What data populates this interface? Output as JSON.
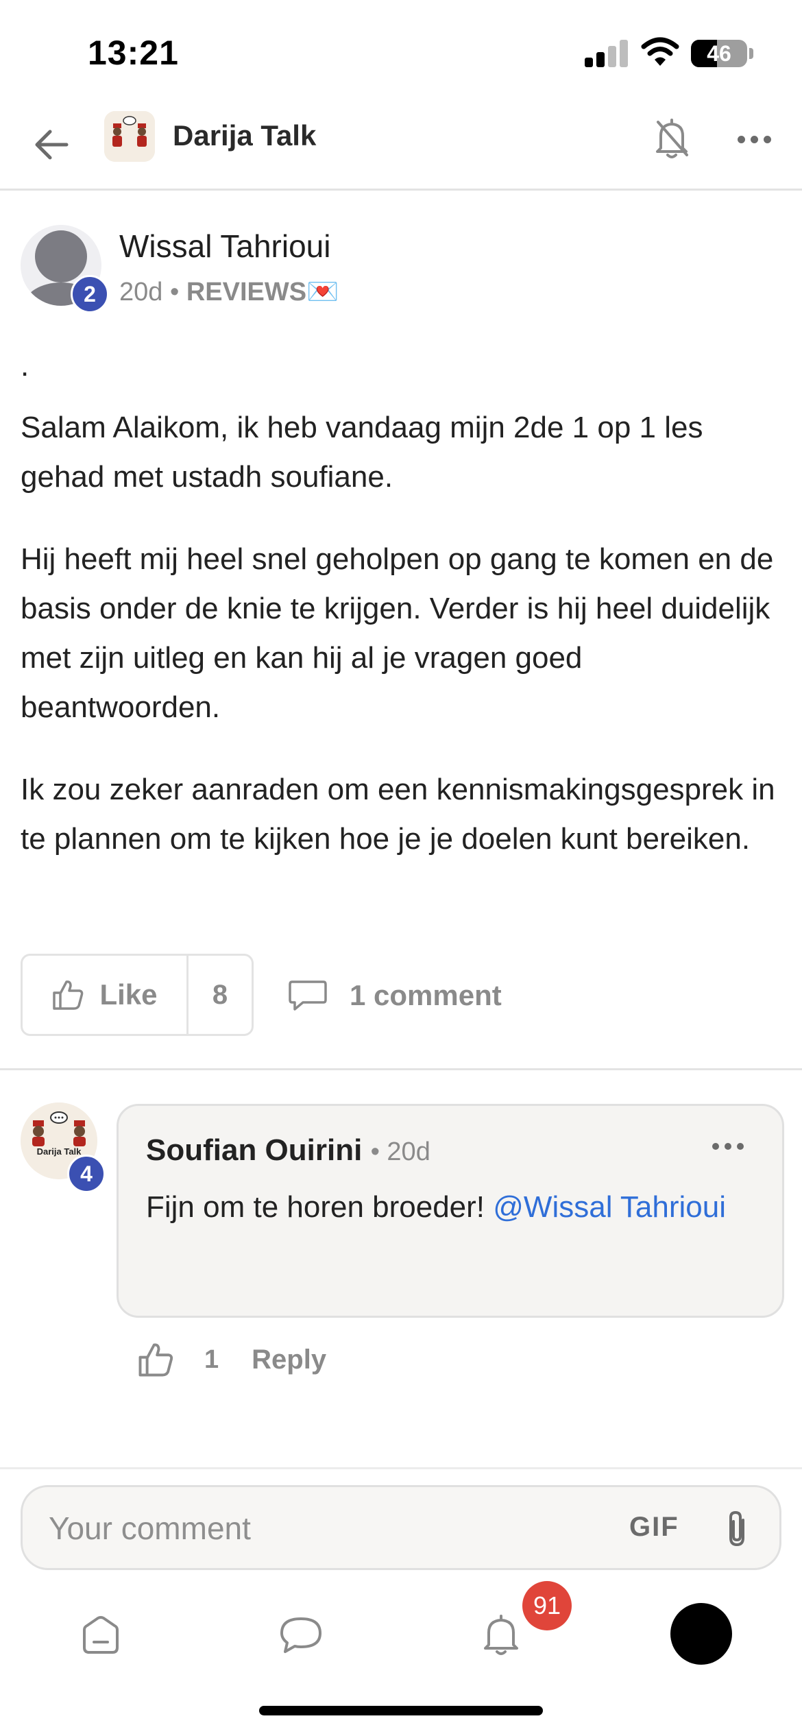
{
  "status_bar": {
    "time": "13:21",
    "battery_level": "46"
  },
  "header": {
    "group_title": "Darija Talk",
    "logo_text": "Darija Talk"
  },
  "post": {
    "author_name": "Wissal Tahrioui",
    "author_level": "2",
    "time_ago": "20d",
    "separator": "•",
    "category": "REVIEWS💌",
    "paragraphs": [
      ".",
      "Salam Alaikom, ik heb vandaag mijn 2de 1 op 1 les gehad met ustadh soufiane.",
      "Hij heeft mij heel snel geholpen op gang te komen en de basis onder de knie te krijgen. Verder is hij heel duidelijk met zijn uitleg en kan hij al je vragen goed beantwoorden.",
      "Ik zou zeker aanraden om een kennismakingsgesprek in te plannen om te kijken hoe je je doelen kunt bereiken."
    ],
    "like_label": "Like",
    "like_count": "8",
    "comment_count_label": "1 comment"
  },
  "comment": {
    "author_name": "Soufian Ouirini",
    "author_level": "4",
    "time_ago": "• 20d",
    "text": "Fijn om te horen broeder! ",
    "mention": "@Wissal Tahrioui",
    "like_count": "1",
    "reply_label": "Reply"
  },
  "composer": {
    "placeholder": "Your comment",
    "gif_label": "GIF"
  },
  "tab_bar": {
    "notification_count": "91",
    "tabs": [
      "home-icon",
      "chat-icon",
      "notifications-icon",
      "profile-avatar"
    ]
  },
  "colors": {
    "accent_blue": "#3b50b2",
    "mention_blue": "#2f6ed8",
    "badge_red": "#e0453a"
  }
}
